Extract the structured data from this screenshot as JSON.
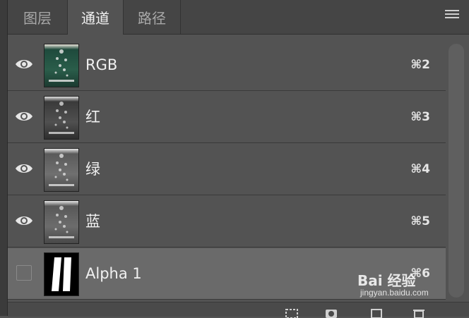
{
  "tabs": [
    {
      "label": "图层",
      "active": false
    },
    {
      "label": "通道",
      "active": true
    },
    {
      "label": "路径",
      "active": false
    }
  ],
  "panel_menu_icon": "hamburger-menu-icon",
  "channels": [
    {
      "name": "RGB",
      "shortcut": "⌘2",
      "visible": true,
      "selected": false,
      "thumb": "color"
    },
    {
      "name": "红",
      "shortcut": "⌘3",
      "visible": true,
      "selected": false,
      "thumb": "gray"
    },
    {
      "name": "绿",
      "shortcut": "⌘4",
      "visible": true,
      "selected": false,
      "thumb": "gray"
    },
    {
      "name": "蓝",
      "shortcut": "⌘5",
      "visible": true,
      "selected": false,
      "thumb": "gray"
    },
    {
      "name": "Alpha 1",
      "shortcut": "⌘6",
      "visible": false,
      "selected": true,
      "thumb": "alpha"
    }
  ],
  "bottom_icons": [
    "load-selection-icon",
    "save-selection-icon",
    "new-channel-icon",
    "delete-channel-icon"
  ],
  "watermark": {
    "logo": "Bai 经验",
    "sub": "jingyan.baidu.com"
  },
  "colors": {
    "panel_bg": "#535353",
    "selected_row": "#6a6a6a",
    "tab_bar": "#454545"
  }
}
